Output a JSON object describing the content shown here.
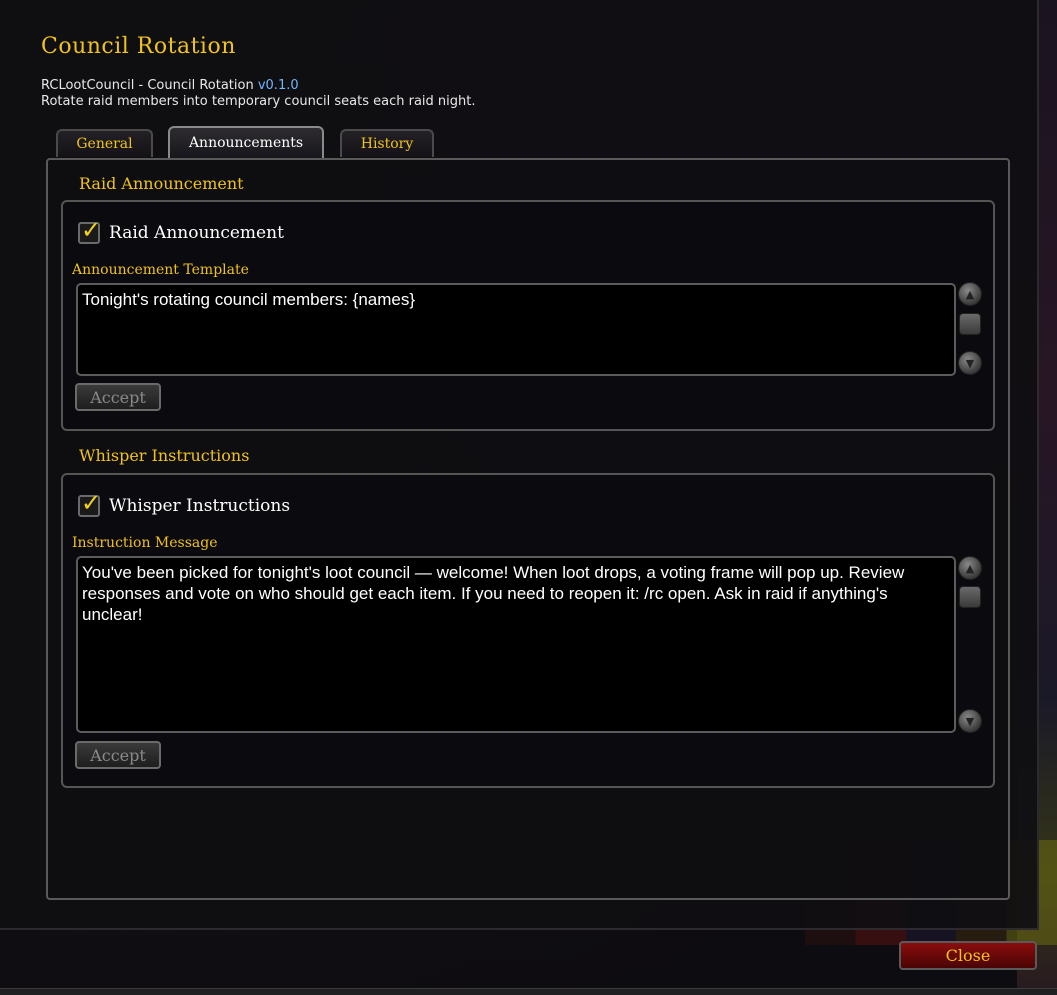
{
  "window": {
    "title": "Council Rotation",
    "subtitle_prefix": "RCLootCouncil - Council Rotation ",
    "version": "v0.1.0",
    "description": "Rotate raid members into temporary council seats each raid night."
  },
  "tabs": [
    {
      "label": "General",
      "active": false
    },
    {
      "label": "Announcements",
      "active": true
    },
    {
      "label": "History",
      "active": false
    }
  ],
  "raid_announcement": {
    "group_title": "Raid Announcement",
    "checkbox_label": "Raid Announcement",
    "checked": true,
    "field_label": "Announcement Template",
    "value": "Tonight's rotating council members: {names}",
    "accept_label": "Accept"
  },
  "whisper_instructions": {
    "group_title": "Whisper Instructions",
    "checkbox_label": "Whisper Instructions",
    "checked": true,
    "field_label": "Instruction Message",
    "value": "You've been picked for tonight's loot council — welcome! When loot drops, a voting frame will pop up. Review responses and vote on who should get each item. If you need to reopen it: /rc open. Ask in raid if anything's unclear!",
    "accept_label": "Accept"
  },
  "footer": {
    "close_label": "Close"
  },
  "icons": {
    "check": "checkmark-icon",
    "scroll_up": "scroll-up-arrow-icon",
    "scroll_down": "scroll-down-arrow-icon"
  },
  "colors": {
    "accent_gold": "#f0c21e",
    "version_blue": "#6fb5ff",
    "close_red": "#8a0d0d"
  }
}
